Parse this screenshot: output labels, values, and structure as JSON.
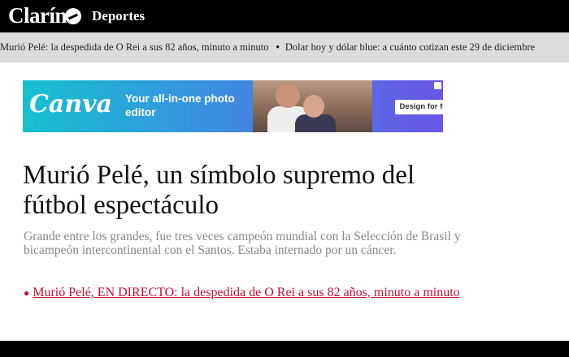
{
  "header": {
    "logo_text": "Clarín",
    "section": "Deportes"
  },
  "ticker": {
    "items": [
      "Murió Pelé: la despedida de O Rei a sus 82 años, minuto a minuto",
      "Dolar hoy y dólar blue: a cuánto cotizan este 29 de diciembre"
    ]
  },
  "ad": {
    "brand": "Canva",
    "tagline": "Your all-in-one photo editor",
    "cta": "Design for free"
  },
  "article": {
    "headline": "Murió Pelé, un símbolo supremo del fútbol espectáculo",
    "summary": "Grande entre los grandes, fue tres veces campeón mundial con la Selección de Brasil y bicampeón intercontinental con el Santos. Estaba internado por un cáncer.",
    "live_link": "Murió Pelé, EN DIRECTO: la despedida de O Rei a sus 82 años, minuto a minuto"
  },
  "colors": {
    "link_red": "#c4102e",
    "ticker_bg": "#dcdcdc"
  }
}
